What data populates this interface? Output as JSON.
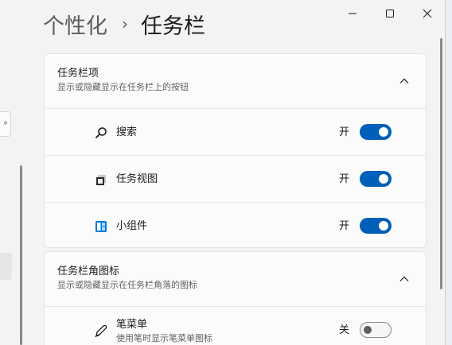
{
  "breadcrumb": {
    "parent": "个性化",
    "separator": "›",
    "current": "任务栏"
  },
  "window_controls": [
    "minimize-icon",
    "maximize-icon",
    "close-icon"
  ],
  "taskbar_items": {
    "title": "任务栏项",
    "subtitle": "显示或隐藏显示在任务栏上的按钮",
    "expanded": true,
    "items": [
      {
        "icon": "search-icon",
        "label": "搜索",
        "state_text": "开",
        "on": true
      },
      {
        "icon": "task-view-icon",
        "label": "任务视图",
        "state_text": "开",
        "on": true
      },
      {
        "icon": "widgets-icon",
        "label": "小组件",
        "state_text": "开",
        "on": true
      }
    ]
  },
  "corner_icons": {
    "title": "任务栏角图标",
    "subtitle": "显示或隐藏显示在任务栏角落的图标",
    "expanded": true,
    "items": [
      {
        "icon": "pen-icon",
        "label": "笔菜单",
        "sublabel": "使用笔时显示笔菜单图标",
        "state_text": "关",
        "on": false
      }
    ]
  },
  "colors": {
    "accent": "#005fb8",
    "background": "#f3f3f3",
    "card": "#fbfbfb"
  }
}
